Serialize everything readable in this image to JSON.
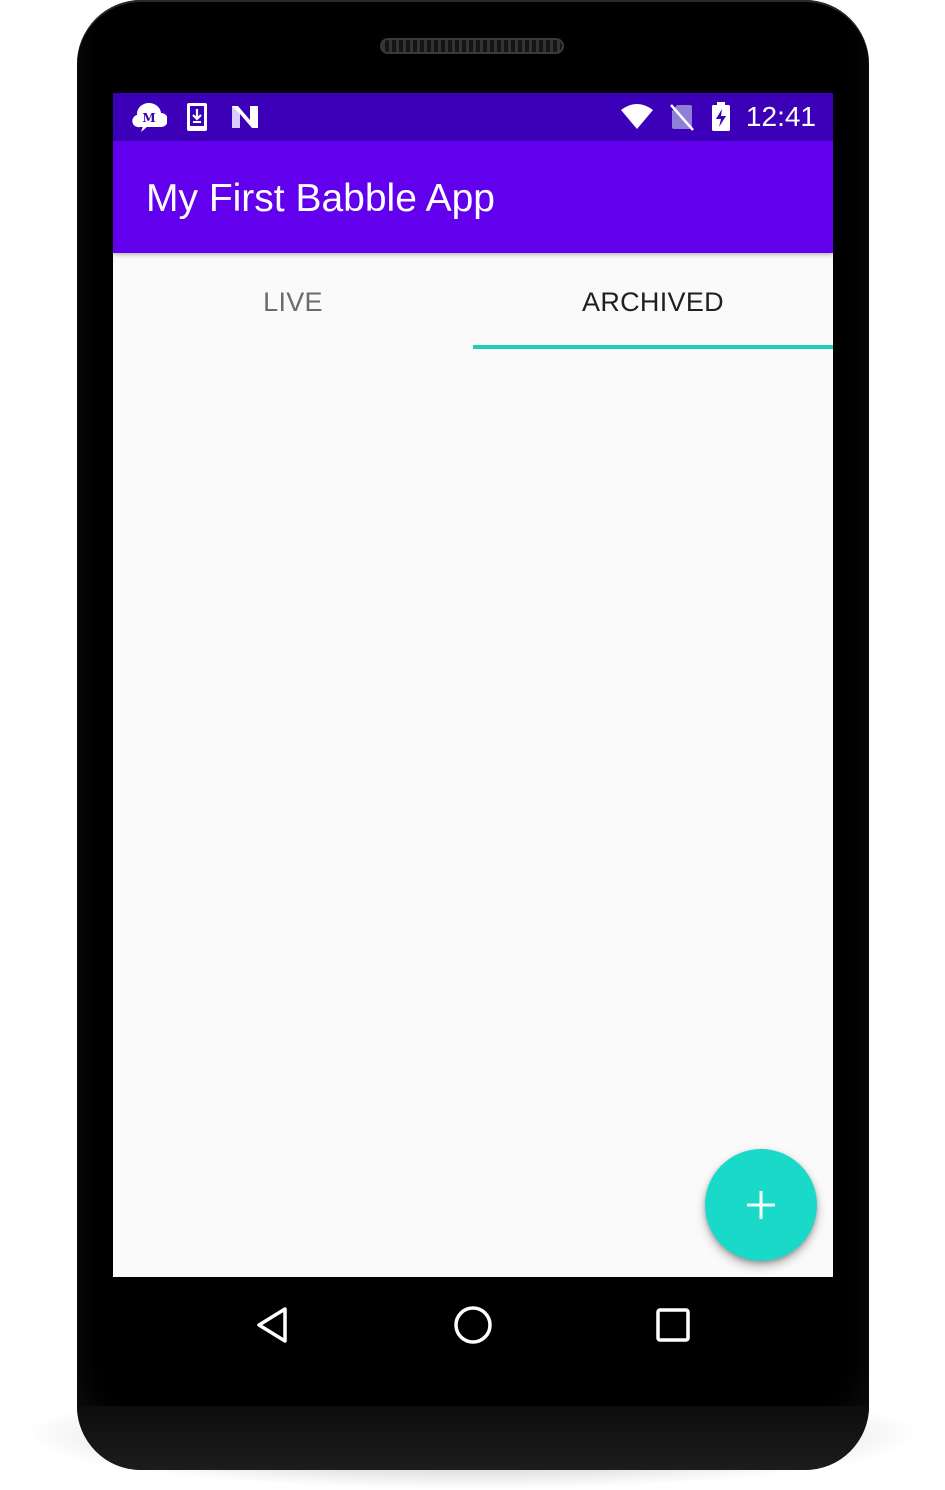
{
  "status_bar": {
    "time": "12:41",
    "left_icons": [
      "messenger-icon",
      "download-icon",
      "n-notification-icon"
    ],
    "right_icons": [
      "wifi-icon",
      "no-sim-icon",
      "battery-charging-icon"
    ],
    "background": "#3b00b8"
  },
  "app_bar": {
    "title": "My First Babble App",
    "background": "#6200ee"
  },
  "tabs": [
    {
      "label": "LIVE",
      "selected": false
    },
    {
      "label": "ARCHIVED",
      "selected": true
    }
  ],
  "tab_indicator_color": "#1ccdc0",
  "content": {
    "items": []
  },
  "fab": {
    "icon": "plus-icon",
    "color": "#19dac8"
  },
  "nav_bar": {
    "buttons": [
      "back-icon",
      "home-icon",
      "recents-icon"
    ]
  }
}
